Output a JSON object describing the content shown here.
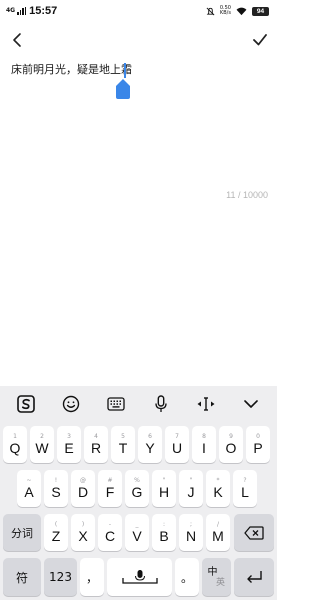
{
  "status_bar": {
    "network": "4G",
    "time": "15:57",
    "speed_value": "0.50",
    "speed_unit": "KB/s",
    "battery": "94"
  },
  "editor": {
    "text": "床前明月光，疑是地上霜",
    "counter": "11 / 10000"
  },
  "keyboard": {
    "toolbar": [
      "sogou-logo-icon",
      "emoji-icon",
      "keyboard-icon",
      "microphone-icon",
      "cursor-move-icon",
      "collapse-chevron-icon"
    ],
    "row1": [
      {
        "main": "Q",
        "hint": "1"
      },
      {
        "main": "W",
        "hint": "2"
      },
      {
        "main": "E",
        "hint": "3"
      },
      {
        "main": "R",
        "hint": "4"
      },
      {
        "main": "T",
        "hint": "5"
      },
      {
        "main": "Y",
        "hint": "6"
      },
      {
        "main": "U",
        "hint": "7"
      },
      {
        "main": "I",
        "hint": "8"
      },
      {
        "main": "O",
        "hint": "9"
      },
      {
        "main": "P",
        "hint": "0"
      }
    ],
    "row2": [
      {
        "main": "A",
        "hint": "~"
      },
      {
        "main": "S",
        "hint": "!"
      },
      {
        "main": "D",
        "hint": "@"
      },
      {
        "main": "F",
        "hint": "#"
      },
      {
        "main": "G",
        "hint": "%"
      },
      {
        "main": "H",
        "hint": "\""
      },
      {
        "main": "J",
        "hint": "\""
      },
      {
        "main": "K",
        "hint": "*"
      },
      {
        "main": "L",
        "hint": "?"
      }
    ],
    "row3": [
      {
        "main": "Z",
        "hint": "("
      },
      {
        "main": "X",
        "hint": ")"
      },
      {
        "main": "C",
        "hint": "-"
      },
      {
        "main": "V",
        "hint": "_"
      },
      {
        "main": "B",
        "hint": ":"
      },
      {
        "main": "N",
        "hint": ";"
      },
      {
        "main": "M",
        "hint": "/"
      }
    ],
    "segment_label": "分词",
    "symbol_label": "符",
    "numbers_label": "123",
    "comma_label": "，",
    "period_label": "。",
    "lang_zh": "中",
    "lang_en": "英"
  },
  "colors": {
    "caret": "#3a86e8",
    "keyboard_bg": "#eeeef0",
    "key_bg": "#ffffff",
    "function_key_bg": "#d7d8dd"
  }
}
